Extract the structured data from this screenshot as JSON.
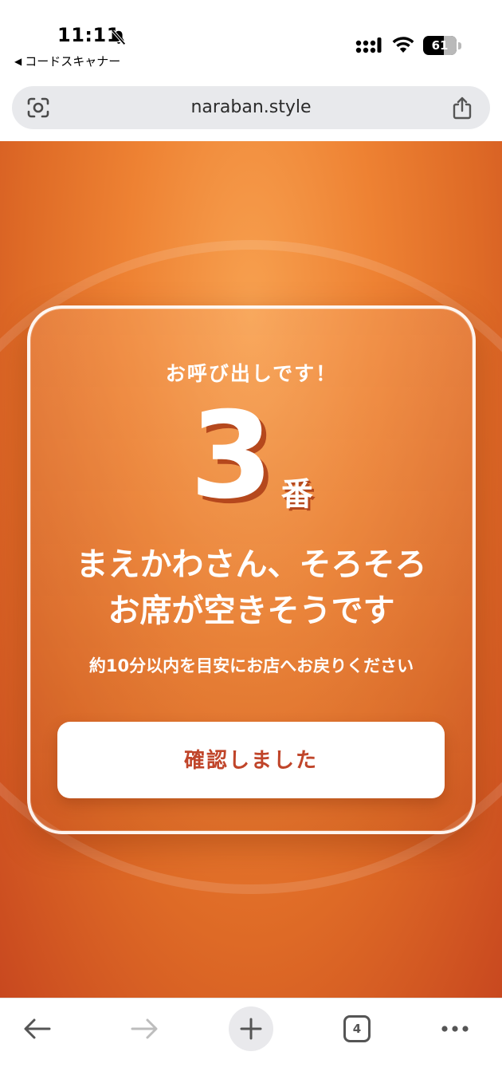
{
  "status_bar": {
    "time": "11:11",
    "back_app_label": "コードスキャナー",
    "battery_level": "61",
    "icons": [
      "bell-slash-icon",
      "signal-icon",
      "wifi-icon",
      "battery-icon"
    ]
  },
  "address_bar": {
    "url": "naraban.style",
    "icons": [
      "camera-lens-icon",
      "share-icon"
    ]
  },
  "page": {
    "call_text": "お呼び出しです！",
    "queue_number": "3",
    "number_suffix": "番",
    "message_line1": "まえかわさん、そろそろ",
    "message_line2": "お席が空きそうです",
    "sub_message": "約10分以内を目安にお店へお戻りください",
    "confirm_button": "確認しました",
    "colors": {
      "background_top": "#f7a04f",
      "background_bottom": "#c8481f",
      "button_text": "#c0452a"
    }
  },
  "toolbar": {
    "tab_count": "4",
    "icons": [
      "back-arrow-icon",
      "forward-arrow-icon",
      "plus-icon",
      "tabs-icon",
      "more-icon"
    ]
  }
}
